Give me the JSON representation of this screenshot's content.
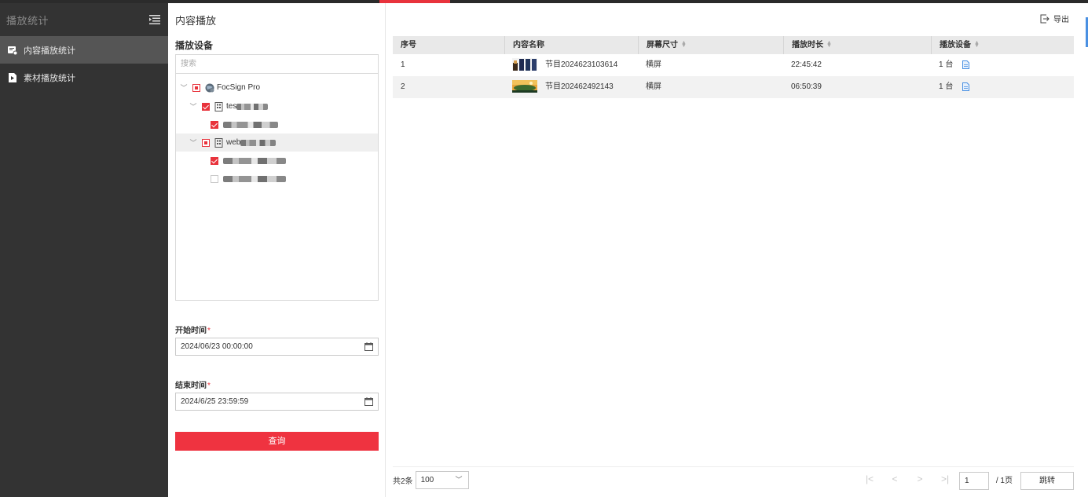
{
  "sidebar": {
    "title": "播放统计",
    "items": [
      {
        "label": "内容播放统计",
        "icon": "report-icon",
        "active": true
      },
      {
        "label": "素材播放统计",
        "icon": "play-file-icon",
        "active": false
      }
    ]
  },
  "panel": {
    "title": "内容播放",
    "device_label": "播放设备",
    "search_placeholder": "搜索",
    "tree": {
      "root": "FocSign Pro",
      "group1": "tes",
      "group2": "web"
    },
    "start_label": "开始时间",
    "start_value": "2024/06/23 00:00:00",
    "end_label": "结束时间",
    "end_value": "2024/6/25 23:59:59",
    "required_mark": "*",
    "query_label": "查询"
  },
  "main": {
    "export_label": "导出",
    "columns": [
      "序号",
      "内容名称",
      "屏幕尺寸",
      "播放时长",
      "播放设备"
    ],
    "rows": [
      {
        "index": "1",
        "name": "节目2024623103614",
        "size": "横屏",
        "duration": "22:45:42",
        "devices": "1 台"
      },
      {
        "index": "2",
        "name": "节目202462492143",
        "size": "横屏",
        "duration": "06:50:39",
        "devices": "1 台"
      }
    ],
    "pager": {
      "total": "共2条",
      "page_size": "100",
      "current_page": "1",
      "total_pages": "/ 1页",
      "jump_label": "跳转"
    }
  },
  "colors": {
    "accent": "#e8333c",
    "sidebar_bg": "#333333",
    "link_blue": "#4a90e2"
  }
}
